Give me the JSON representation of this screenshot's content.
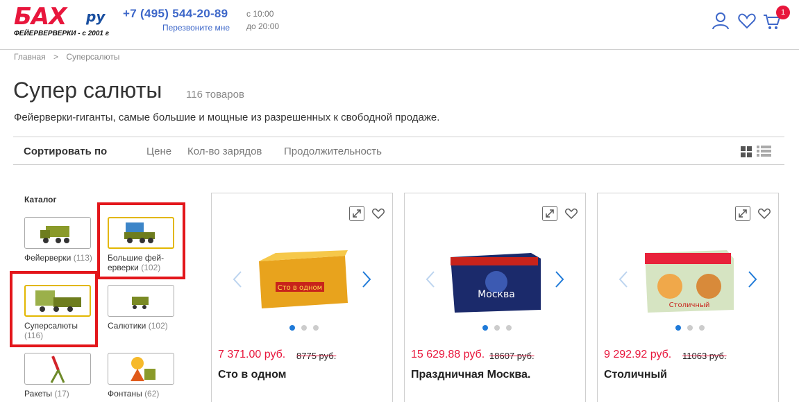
{
  "header": {
    "logo_main": "БАХ",
    "logo_ru": "ру",
    "logo_sub": "ФЕЙЕРВЕРВЕРКИ - с 2001 г",
    "phone": "+7 (495) 544-20-89",
    "callback": "Перезвоните мне",
    "hours_from": "с 10:00",
    "hours_to": "до 20:00",
    "cart_count": "1",
    "icons": [
      "user-icon",
      "heart-icon",
      "cart-icon"
    ]
  },
  "breadcrumb": [
    "Главная",
    ">",
    "Суперсалюты"
  ],
  "page": {
    "title": "Супер салюты",
    "count": "116 товаров",
    "description": "Фейерверки-гиганты, самые большие и мощные из разрешенных к свободной продаже."
  },
  "sort": {
    "label": "Сортировать по",
    "options": [
      "Цене",
      "Кол-во зарядов",
      "Продолжительность"
    ]
  },
  "catalog": {
    "title": "Каталог",
    "items": [
      {
        "label": "Фейерверки",
        "count": "(113)"
      },
      {
        "label": "Большие фей-\nерверки",
        "count": "(102)"
      },
      {
        "label": "Суперсалюты",
        "count": "(116)"
      },
      {
        "label": "Салютики",
        "count": "(102)"
      },
      {
        "label": "Ракеты",
        "count": "(17)"
      },
      {
        "label": "Фонтаны",
        "count": "(62)"
      }
    ]
  },
  "products": [
    {
      "price": "7 371.00 руб.",
      "old_price": "8775 руб.",
      "name": "Сто в одном",
      "img_text": "Сто в одном"
    },
    {
      "price": "15 629.88 руб.",
      "old_price": "18607 руб.",
      "name": "Праздничная Москва.",
      "img_text": "Москва"
    },
    {
      "price": "9 292.92 руб.",
      "old_price": "11063 руб.",
      "name": "Столичный",
      "img_text": "Столичный"
    }
  ],
  "colors": {
    "accent": "#e8163c",
    "link": "#3d67c9",
    "highlight": "#e3161b",
    "active_border": "#e2b700"
  }
}
